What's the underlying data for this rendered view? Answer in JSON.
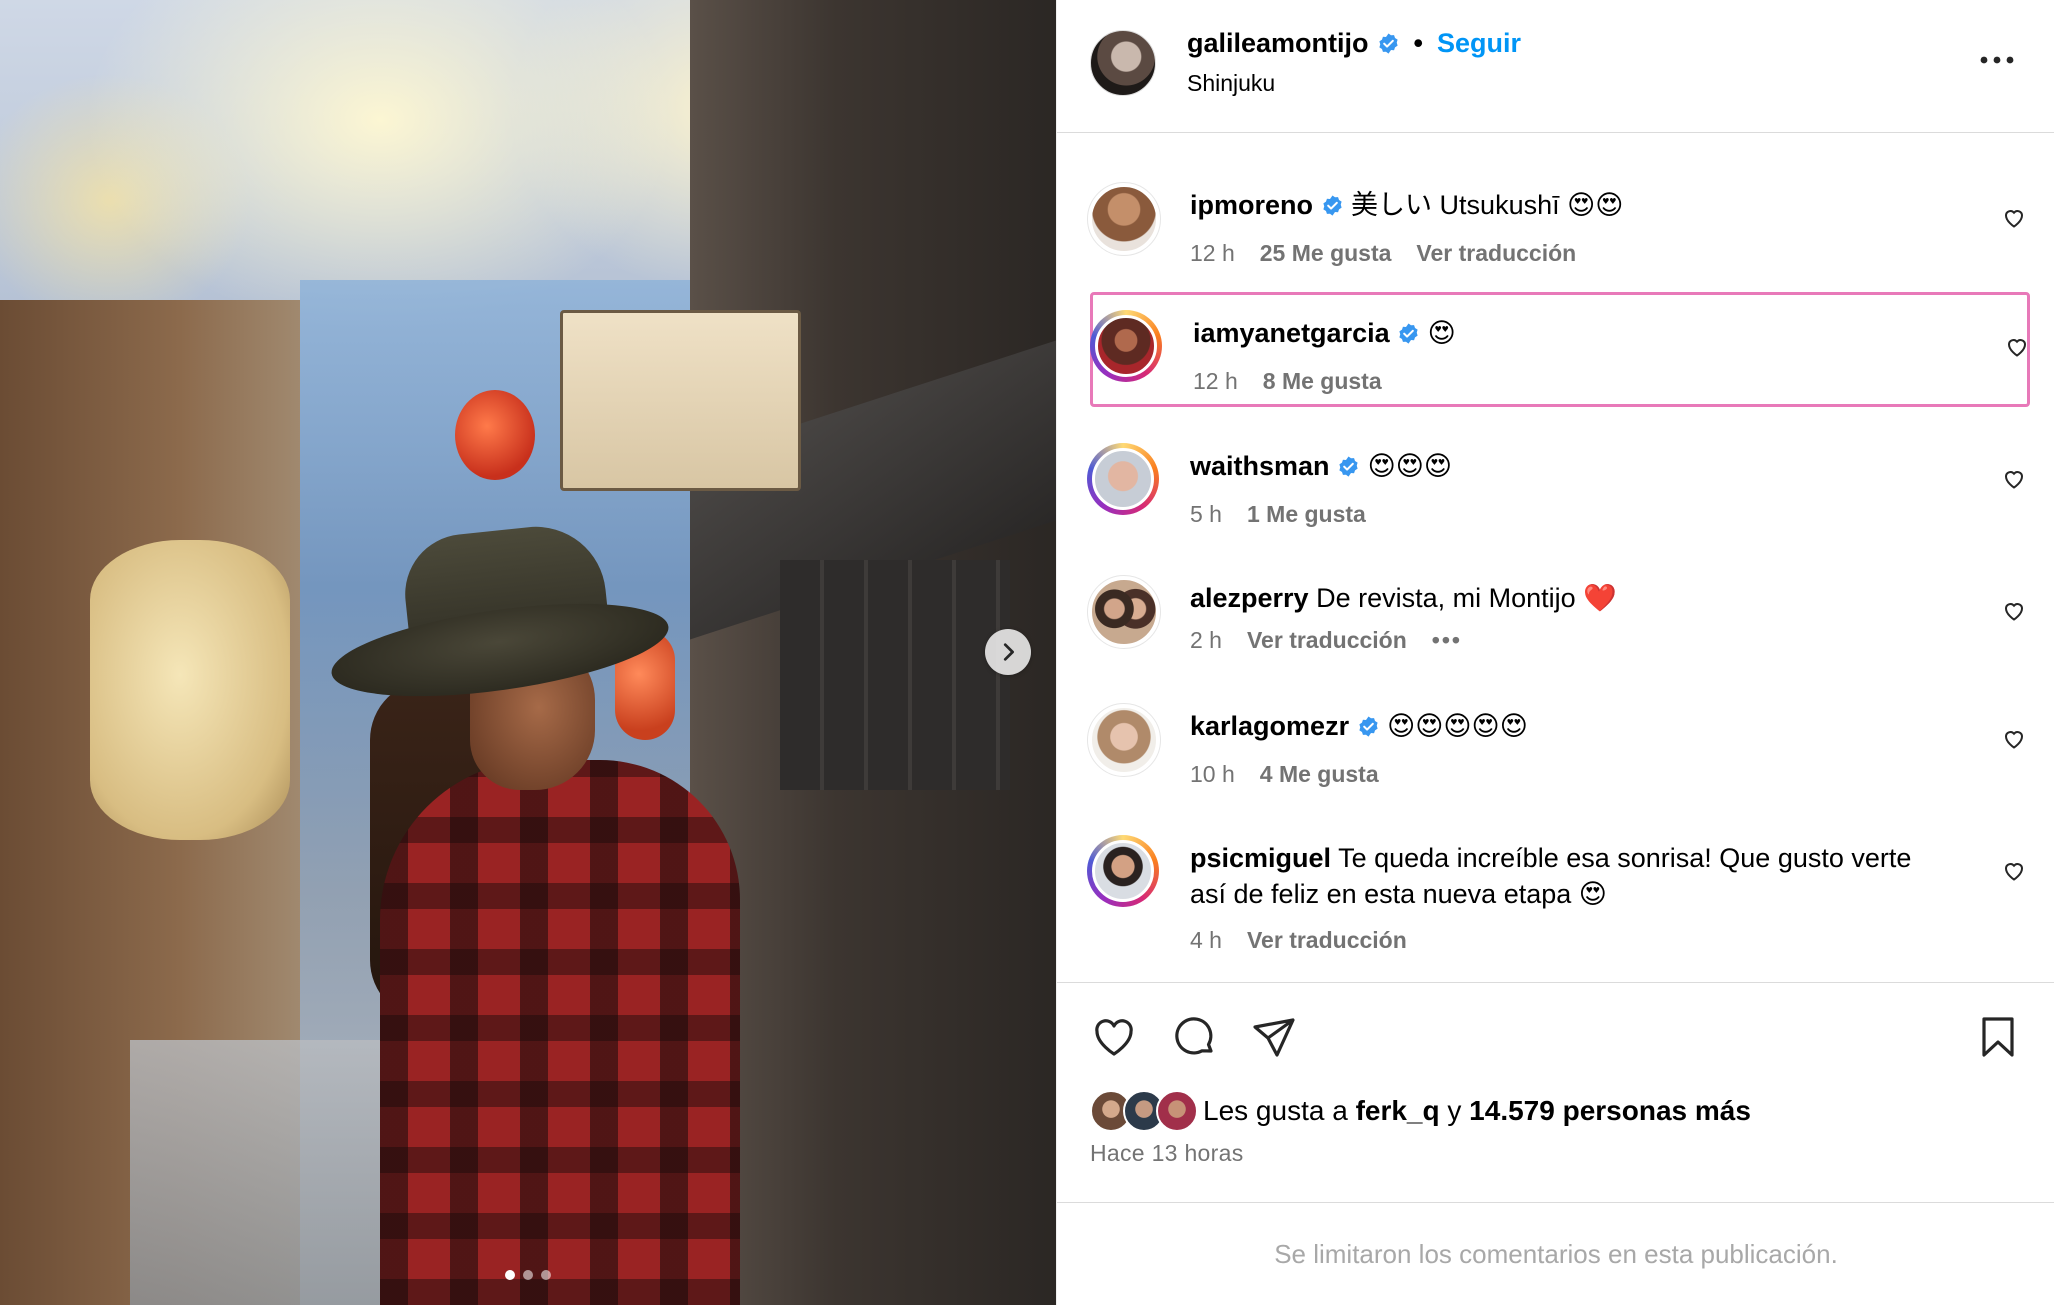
{
  "header": {
    "username": "galileamontijo",
    "separator": "•",
    "follow_label": "Seguir",
    "location": "Shinjuku"
  },
  "comments": [
    {
      "user": "ipmoreno",
      "verified": true,
      "text": "美しい Utsukushī 😍😍",
      "time": "12 h",
      "likes": "25 Me gusta",
      "action": "Ver traducción",
      "ring": false
    },
    {
      "user": "iamyanetgarcia",
      "verified": true,
      "text": "😍",
      "time": "12 h",
      "likes": "8 Me gusta",
      "action": "",
      "ring": true,
      "highlighted": true
    },
    {
      "user": "waithsman",
      "verified": true,
      "text": "😍😍😍",
      "time": "5 h",
      "likes": "1 Me gusta",
      "action": "",
      "ring": true
    },
    {
      "user": "alezperry",
      "verified": false,
      "text": "De revista, mi Montijo ❤️",
      "time": "2 h",
      "likes": "",
      "action": "Ver traducción",
      "more": "•••",
      "ring": false
    },
    {
      "user": "karlagomezr",
      "verified": true,
      "text": "😍😍😍😍😍",
      "time": "10 h",
      "likes": "4 Me gusta",
      "action": "",
      "ring": false
    },
    {
      "user": "psicmiguel",
      "verified": false,
      "text": "Te queda increíble esa sonrisa! Que gusto verte así de feliz en esta nueva etapa 😍",
      "time": "4 h",
      "likes": "",
      "action": "Ver traducción",
      "ring": true
    }
  ],
  "likes": {
    "prefix": "Les gusta a",
    "user": "ferk_q",
    "conj": "y",
    "others": "14.579 personas más"
  },
  "time_ago": "Hace 13 horas",
  "limited_comments": "Se limitaron los comentarios en esta publicación.",
  "carousel": {
    "count": 3,
    "active": 0
  },
  "colors": {
    "accent": "#0095f6",
    "highlight": "#e879b9",
    "muted": "#737373"
  }
}
